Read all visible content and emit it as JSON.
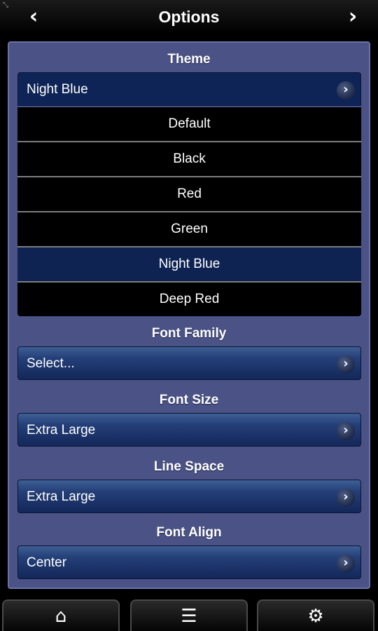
{
  "header": {
    "title": "Options",
    "back_icon": "chevron-left-icon",
    "forward_icon": "chevron-right-icon",
    "corner_icon": "expand-icon"
  },
  "theme": {
    "label": "Theme",
    "current": "Night Blue",
    "options": [
      "Default",
      "Black",
      "Red",
      "Green",
      "Night Blue",
      "Deep Red"
    ],
    "selected_index": 4
  },
  "font_family": {
    "label": "Font Family",
    "value": "Select..."
  },
  "font_size": {
    "label": "Font Size",
    "value": "Extra Large"
  },
  "line_space": {
    "label": "Line Space",
    "value": "Extra Large"
  },
  "font_align": {
    "label": "Font Align",
    "value": "Center"
  },
  "bottom_bar": {
    "icons": [
      "home-icon",
      "menu-icon",
      "gear-icon"
    ]
  },
  "colors": {
    "panel": "#4a5286",
    "selected_row": "#0e2352",
    "button": "#243f78"
  }
}
